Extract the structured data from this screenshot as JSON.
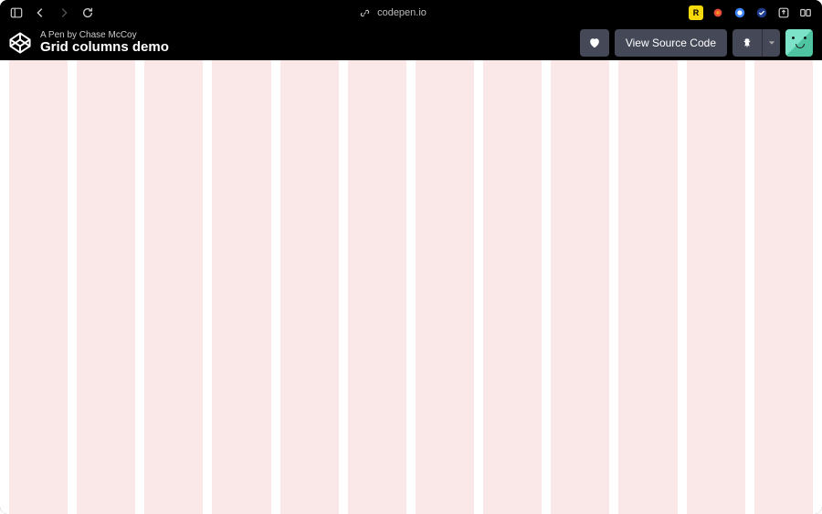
{
  "browser": {
    "url": "codepen.io",
    "ext_badge": "R"
  },
  "header": {
    "byline": "A Pen by Chase McCoy",
    "title": "Grid columns demo",
    "view_source_label": "View Source Code"
  },
  "grid": {
    "columns": 12
  }
}
